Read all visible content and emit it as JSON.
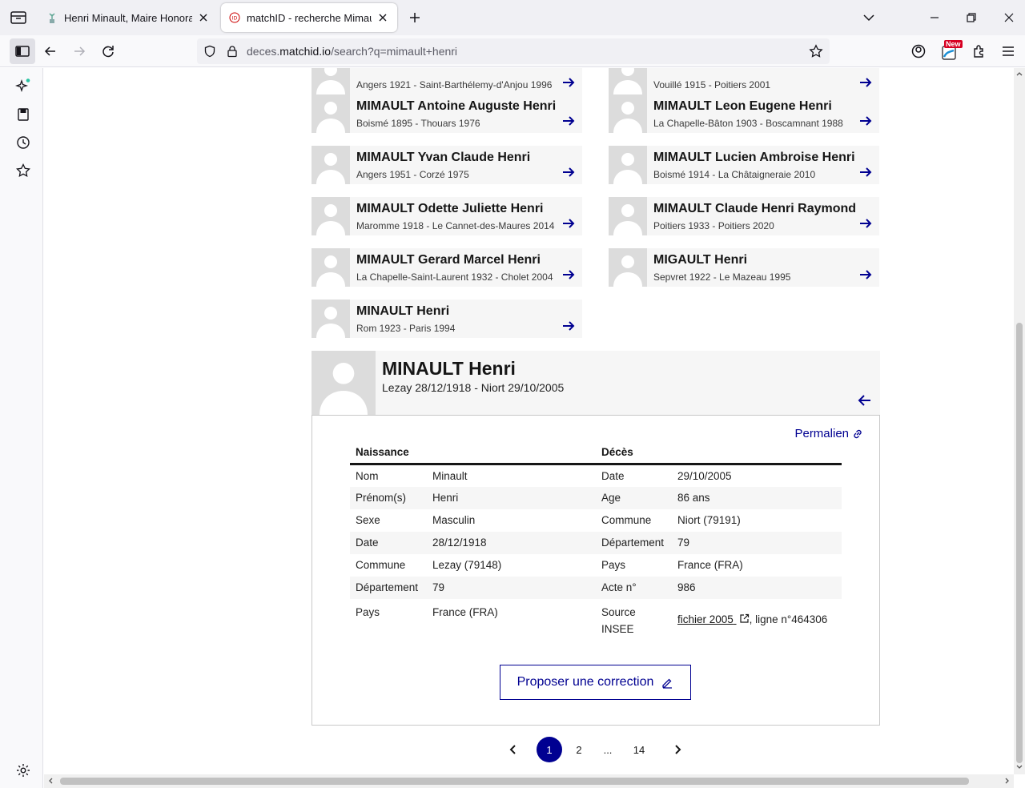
{
  "browser": {
    "tabs": [
      {
        "title": "Henri Minault, Maire Honoraire",
        "active": false
      },
      {
        "title": "matchID - recherche Mimault H",
        "active": true
      }
    ],
    "url_prefix": "deces.",
    "url_domain": "matchid.io",
    "url_path": "/search?q=mimault+henri",
    "new_badge": "New"
  },
  "results": [
    {
      "name": "",
      "life": "Angers 1921 - Saint-Barthélemy-d'Anjou 1996"
    },
    {
      "name": "",
      "life": "Vouillé 1915 - Poitiers 2001"
    },
    {
      "name": "MIMAULT Antoine Auguste Henri",
      "life": "Boismé 1895 - Thouars 1976"
    },
    {
      "name": "MIMAULT Leon Eugene Henri",
      "life": "La Chapelle-Bâton 1903 - Boscamnant 1988"
    },
    {
      "name": "MIMAULT Yvan Claude Henri",
      "life": "Angers 1951 - Corzé 1975"
    },
    {
      "name": "MIMAULT Lucien Ambroise Henri",
      "life": "Boismé 1914 - La Châtaigneraie 2010"
    },
    {
      "name": "MIMAULT Odette Juliette Henri",
      "life": "Maromme 1918 - Le Cannet-des-Maures 2014"
    },
    {
      "name": "MIMAULT Claude Henri Raymond",
      "life": "Poitiers 1933 - Poitiers 2020"
    },
    {
      "name": "MIMAULT Gerard Marcel Henri",
      "life": "La Chapelle-Saint-Laurent 1932 - Cholet 2004"
    },
    {
      "name": "MIGAULT Henri",
      "life": "Sepvret 1922 - Le Mazeau 1995"
    },
    {
      "name": "MINAULT Henri",
      "life": "Rom 1923 - Paris 1994"
    }
  ],
  "detail": {
    "name": "MINAULT Henri",
    "life": "Lezay 28/12/1918 - Niort 29/10/2005",
    "permalink": "Permalien",
    "birth_header": "Naissance",
    "death_header": "Décès",
    "rows": [
      {
        "bl": "Nom",
        "bv": "Minault",
        "dl": "Date",
        "dv": "29/10/2005"
      },
      {
        "bl": "Prénom(s)",
        "bv": "Henri",
        "dl": "Age",
        "dv": "86 ans"
      },
      {
        "bl": "Sexe",
        "bv": "Masculin",
        "dl": "Commune",
        "dv": "Niort (79191)"
      },
      {
        "bl": "Date",
        "bv": "28/12/1918",
        "dl": "Département",
        "dv": "79"
      },
      {
        "bl": "Commune",
        "bv": "Lezay (79148)",
        "dl": "Pays",
        "dv": "France (FRA)"
      },
      {
        "bl": "Département",
        "bv": "79",
        "dl": "Acte n°",
        "dv": "986"
      }
    ],
    "last_row": {
      "bl": "Pays",
      "bv": "France (FRA)",
      "dl": "Source INSEE",
      "file_link": "fichier 2005",
      "line": ", ligne n°464306"
    },
    "correction": "Proposer une correction"
  },
  "pagination": {
    "pages": [
      "1",
      "2",
      "...",
      "14"
    ],
    "current": "1"
  }
}
